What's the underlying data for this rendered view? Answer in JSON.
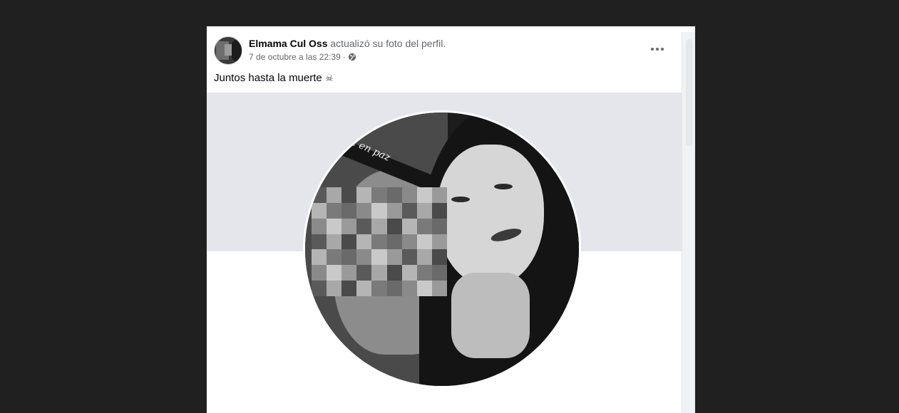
{
  "post": {
    "author": "Elmama Cul Oss",
    "action": "actualizó su foto del perfil.",
    "timestamp": "7 de octubre a las 22:39",
    "separator": "·",
    "privacy_icon": "globe-icon",
    "more_icon": "more-options-icon",
    "caption": "Juntos hasta la muerte",
    "caption_emoji": "☠",
    "photo": {
      "ribbon_text": "sa en paz",
      "blurred_region": "pixelated face"
    }
  },
  "colors": {
    "background": "#202020",
    "card": "#ffffff",
    "cover": "#e4e6eb",
    "text_primary": "#050505",
    "text_secondary": "#65676b"
  }
}
